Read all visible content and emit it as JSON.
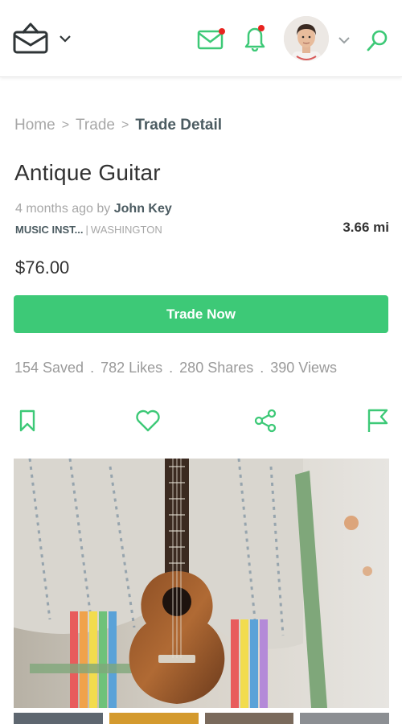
{
  "header": {
    "logo_icon": "shopping-bag-icon",
    "logo_menu_icon": "chevron-down-icon",
    "mail_icon": "mail-icon",
    "bell_icon": "bell-icon",
    "profile_menu_icon": "chevron-down-icon",
    "search_icon": "search-icon",
    "accent_color": "#3dc977",
    "notification_dot_color": "#e8231f"
  },
  "breadcrumb": {
    "items": [
      "Home",
      "Trade",
      "Trade Detail"
    ],
    "separator": ">"
  },
  "listing": {
    "title": "Antique Guitar",
    "posted": "4 months ago by",
    "author": "John Key",
    "category": "MUSIC INST...",
    "divider": "|",
    "location": "WASHINGTON",
    "distance": "3.66 mi",
    "price": "$76.00"
  },
  "trade_button": {
    "label": "Trade Now",
    "color": "#3dc977"
  },
  "stats": {
    "saved": "154 Saved",
    "likes": "782 Likes",
    "shares": "280 Shares",
    "views": "390 Views",
    "separator": "."
  },
  "actions": [
    {
      "icon": "bookmark-icon"
    },
    {
      "icon": "heart-icon"
    },
    {
      "icon": "share-icon"
    },
    {
      "icon": "flag-icon"
    }
  ]
}
